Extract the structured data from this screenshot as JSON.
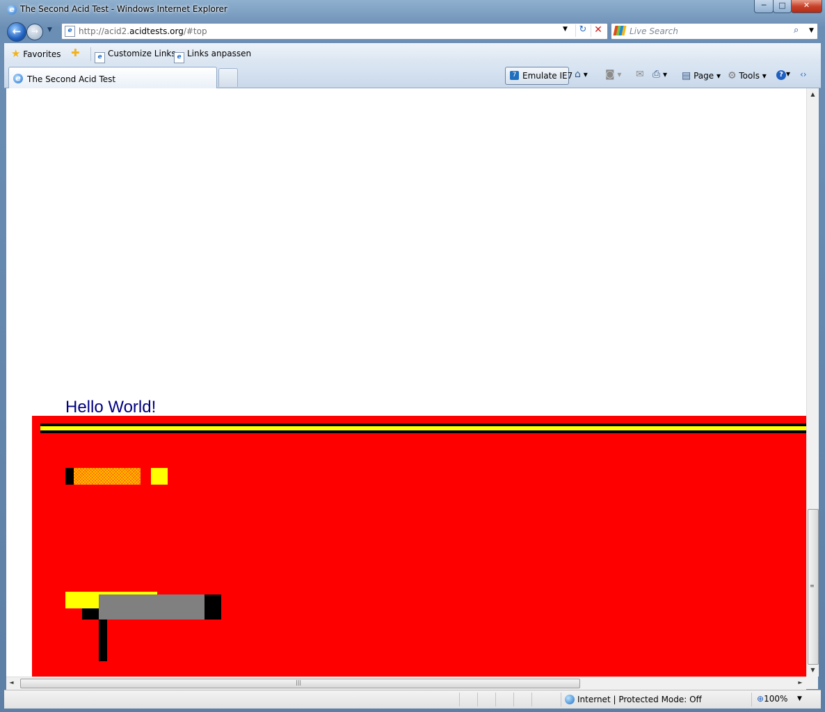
{
  "window": {
    "title": "The Second Acid Test - Windows Internet Explorer",
    "minimize": "─",
    "maximize": "□",
    "close": "✕"
  },
  "navigation": {
    "url_prefix": "http://acid2.",
    "url_domain": "acidtests.org",
    "url_suffix": "/#top",
    "search_placeholder": "Live Search",
    "back_glyph": "←",
    "forward_glyph": "→",
    "dropdown_glyph": "▼",
    "refresh_glyph": "↻",
    "stop_glyph": "✕",
    "search_glyph": "⌕"
  },
  "favorites_bar": {
    "favorites_label": "Favorites",
    "links": [
      "Customize Links",
      "Links anpassen"
    ]
  },
  "tabs": {
    "active_tab_label": "The Second Acid Test"
  },
  "command_bar": {
    "emulate_label": "Emulate IE7",
    "emulate_icon_text": "7",
    "page_label": "Page",
    "tools_label": "Tools",
    "help_glyph": "?",
    "dropdown_glyph": "▾"
  },
  "content": {
    "heading": "Hello World!",
    "colors": {
      "heading": "#000080",
      "face_background": "#ff0000",
      "yellow": "#ffff00",
      "orange": "#ff6600",
      "gray": "#808080",
      "black": "#000000"
    }
  },
  "scrollbars": {
    "up_arrow": "▲",
    "down_arrow": "▼",
    "left_arrow": "◄",
    "right_arrow": "►",
    "grip": "≡",
    "hgrip": "|||"
  },
  "status_bar": {
    "zone_label": "Internet | Protected Mode: Off",
    "zoom_label": "100%",
    "zoom_glyph": "⊕",
    "dropdown_glyph": "▼"
  }
}
